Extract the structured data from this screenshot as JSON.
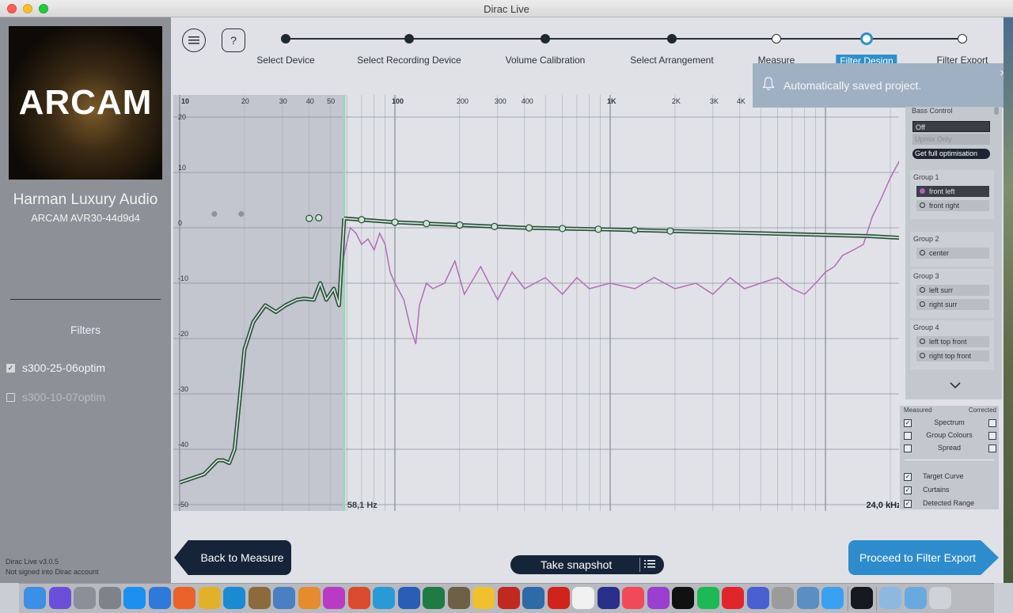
{
  "window": {
    "title": "Dirac Live"
  },
  "sidebar": {
    "logo_text": "ARCAM",
    "device_name": "Harman Luxury Audio",
    "device_model": "ARCAM AVR30-44d9d4",
    "filters_title": "Filters",
    "filters": [
      {
        "label": "s300-25-06optim",
        "checked": true
      },
      {
        "label": "s300-10-07optim",
        "checked": false
      }
    ],
    "version": "Dirac Live v3.0.5",
    "account_status": "Not signed into Dirac account"
  },
  "steps": [
    {
      "label": "Select Device",
      "state": "done"
    },
    {
      "label": "Select Recording Device",
      "state": "done"
    },
    {
      "label": "Volume Calibration",
      "state": "done"
    },
    {
      "label": "Select Arrangement",
      "state": "done"
    },
    {
      "label": "Measure",
      "state": "todo"
    },
    {
      "label": "Filter Design",
      "state": "active"
    },
    {
      "label": "Filter Export",
      "state": "todo"
    }
  ],
  "toast": {
    "message": "Automatically saved project.",
    "close": "×"
  },
  "chart_data": {
    "type": "line",
    "x_scale": "log",
    "x_tick_labels": [
      "10",
      "20",
      "30",
      "40",
      "50",
      "100",
      "200",
      "300",
      "400",
      "1K",
      "2K",
      "3K",
      "4K"
    ],
    "y_tick_labels": [
      "20",
      "10",
      "0",
      "-10",
      "-20",
      "-30",
      "-40",
      "-50"
    ],
    "ylim": [
      -50,
      20
    ],
    "xlim": [
      10,
      30000
    ],
    "range_low_label": "58,1 Hz",
    "range_high_label": "24,0 kHz",
    "range_low_hz": 58.1,
    "range_high_hz": 24000,
    "series": [
      {
        "role": "measured",
        "color": "#b56cb8",
        "x": [
          58,
          62,
          66,
          70,
          75,
          80,
          85,
          90,
          95,
          100,
          110,
          118,
          125,
          130,
          140,
          150,
          170,
          190,
          210,
          250,
          300,
          350,
          400,
          500,
          600,
          700,
          800,
          1000,
          1300,
          1600,
          2000,
          2500,
          3000,
          3600,
          4200,
          5000,
          6000,
          7000,
          8000,
          9000,
          10000,
          11000,
          12000,
          13500,
          15000,
          16500,
          18000,
          20000,
          22000,
          24000
        ],
        "y": [
          -5,
          0,
          -1,
          -3,
          -2,
          -4,
          -1,
          -3,
          -8,
          -10,
          -13,
          -18,
          -21,
          -14,
          -10,
          -11,
          -10,
          -6,
          -12,
          -7,
          -13,
          -8,
          -11,
          -9,
          -12,
          -9,
          -11,
          -10,
          -11,
          -9,
          -11,
          -10,
          -12,
          -9,
          -11,
          -10,
          -9,
          -11,
          -12,
          -10,
          -8,
          -7,
          -5,
          -4,
          -3,
          2,
          5,
          9,
          12,
          0
        ]
      },
      {
        "role": "target_curve",
        "color": "#3e5a4a",
        "x": [
          58.1,
          100,
          200,
          400,
          1000,
          2000,
          4000,
          8000,
          16000,
          22000,
          24000
        ],
        "y": [
          1.7,
          1.0,
          0.5,
          0,
          -0.3,
          -0.6,
          -0.9,
          -1.2,
          -1.5,
          -1.8,
          -2.1
        ]
      },
      {
        "role": "curtain_low",
        "color": "#3e5a4a",
        "x": [
          10,
          13,
          15,
          16,
          17,
          18,
          19,
          20,
          22,
          25,
          28,
          31,
          35,
          38,
          42,
          45,
          48,
          52,
          55,
          58.1
        ],
        "y": [
          -46,
          -44.5,
          -42,
          -42,
          -42.5,
          -40,
          -31,
          -22,
          -17,
          -14,
          -15.2,
          -14,
          -13,
          -12.8,
          -13,
          -10,
          -13,
          -11,
          -14,
          1.7
        ]
      }
    ],
    "target_points_hz": [
      40,
      70,
      100,
      140,
      200,
      290,
      420,
      600,
      880,
      1300,
      1900
    ],
    "low_points_hz": [
      15,
      20
    ]
  },
  "bass_control": {
    "title": "Bass Control",
    "options": [
      "Off",
      "Upmix Only",
      "Get full optimisation"
    ]
  },
  "groups": [
    {
      "title": "Group 1",
      "channels": [
        {
          "label": "front left",
          "selected": true
        },
        {
          "label": "front right",
          "selected": false
        }
      ]
    },
    {
      "title": "Group 2",
      "channels": [
        {
          "label": "center",
          "selected": false
        }
      ]
    },
    {
      "title": "Group 3",
      "channels": [
        {
          "label": "left surr",
          "selected": false
        },
        {
          "label": "right surr",
          "selected": false
        }
      ]
    },
    {
      "title": "Group 4",
      "channels": [
        {
          "label": "left top front",
          "selected": false
        },
        {
          "label": "right top front",
          "selected": false
        }
      ]
    }
  ],
  "view_options": {
    "measured_header": "Measured",
    "corrected_header": "Corrected",
    "rows": [
      {
        "label": "Spectrum",
        "measured": true,
        "corrected": false
      },
      {
        "label": "Group Colours",
        "measured": false,
        "corrected": false
      },
      {
        "label": "Spread",
        "measured": false,
        "corrected": false
      }
    ],
    "toggles": [
      {
        "label": "Target Curve",
        "checked": true
      },
      {
        "label": "Curtains",
        "checked": true
      },
      {
        "label": "Detected Range",
        "checked": true
      }
    ]
  },
  "buttons": {
    "back": "Back to Measure",
    "snapshot": "Take snapshot",
    "proceed": "Proceed to Filter Export"
  },
  "dock": [
    {
      "name": "finder",
      "color": "#3d8fe6"
    },
    {
      "name": "siri",
      "color": "#6b4fd8"
    },
    {
      "name": "launchpad",
      "color": "#8a8f98"
    },
    {
      "name": "system-preferences",
      "color": "#7f8288"
    },
    {
      "name": "app-store",
      "color": "#1c8ff0"
    },
    {
      "name": "mail",
      "color": "#2f79d8"
    },
    {
      "name": "firefox",
      "color": "#e8622a"
    },
    {
      "name": "chrome",
      "color": "#e2b12a"
    },
    {
      "name": "edge",
      "color": "#1a8ad3"
    },
    {
      "name": "notes-app",
      "color": "#8b6a3c"
    },
    {
      "name": "preview",
      "color": "#4a7fc1"
    },
    {
      "name": "photos",
      "color": "#e48c2e"
    },
    {
      "name": "affinity-photo",
      "color": "#b93bc4"
    },
    {
      "name": "affinity-publisher",
      "color": "#d94a2f"
    },
    {
      "name": "affinity-designer",
      "color": "#2a9ad6"
    },
    {
      "name": "word",
      "color": "#2a5db5"
    },
    {
      "name": "excel",
      "color": "#1f7a44"
    },
    {
      "name": "gimp",
      "color": "#6e6046"
    },
    {
      "name": "cyberduck",
      "color": "#f0c02e"
    },
    {
      "name": "filezilla",
      "color": "#c0291f"
    },
    {
      "name": "remote-app",
      "color": "#2e6aa8"
    },
    {
      "name": "acrobat",
      "color": "#d0231b"
    },
    {
      "name": "text-document",
      "color": "#f0f0f0"
    },
    {
      "name": "rew",
      "color": "#2a2f8a"
    },
    {
      "name": "music",
      "color": "#f04a5a"
    },
    {
      "name": "podcasts",
      "color": "#9a3fcf"
    },
    {
      "name": "apple-tv",
      "color": "#111111"
    },
    {
      "name": "spotify",
      "color": "#1db954"
    },
    {
      "name": "media-player",
      "color": "#e0262a"
    },
    {
      "name": "compressor",
      "color": "#4a5fd0"
    },
    {
      "name": "automator",
      "color": "#9b9b9b"
    },
    {
      "name": "lock-app",
      "color": "#5b8fc4"
    },
    {
      "name": "messages",
      "color": "#3aa0f0"
    },
    {
      "name": "dirac",
      "color": "#15191f"
    },
    {
      "name": "home-folder",
      "color": "#8fb8e0"
    },
    {
      "name": "downloads-folder",
      "color": "#6aa9e0"
    },
    {
      "name": "trash",
      "color": "#cfd2d6"
    }
  ]
}
